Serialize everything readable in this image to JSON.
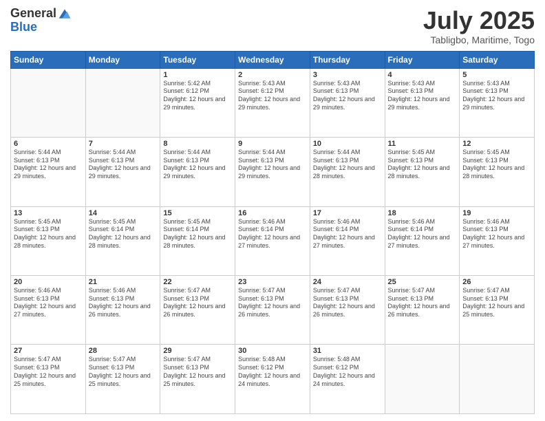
{
  "logo": {
    "general": "General",
    "blue": "Blue"
  },
  "title": "July 2025",
  "subtitle": "Tabligbo, Maritime, Togo",
  "days_of_week": [
    "Sunday",
    "Monday",
    "Tuesday",
    "Wednesday",
    "Thursday",
    "Friday",
    "Saturday"
  ],
  "weeks": [
    [
      {
        "day": "",
        "info": ""
      },
      {
        "day": "",
        "info": ""
      },
      {
        "day": "1",
        "info": "Sunrise: 5:42 AM\nSunset: 6:12 PM\nDaylight: 12 hours and 29 minutes."
      },
      {
        "day": "2",
        "info": "Sunrise: 5:43 AM\nSunset: 6:12 PM\nDaylight: 12 hours and 29 minutes."
      },
      {
        "day": "3",
        "info": "Sunrise: 5:43 AM\nSunset: 6:13 PM\nDaylight: 12 hours and 29 minutes."
      },
      {
        "day": "4",
        "info": "Sunrise: 5:43 AM\nSunset: 6:13 PM\nDaylight: 12 hours and 29 minutes."
      },
      {
        "day": "5",
        "info": "Sunrise: 5:43 AM\nSunset: 6:13 PM\nDaylight: 12 hours and 29 minutes."
      }
    ],
    [
      {
        "day": "6",
        "info": "Sunrise: 5:44 AM\nSunset: 6:13 PM\nDaylight: 12 hours and 29 minutes."
      },
      {
        "day": "7",
        "info": "Sunrise: 5:44 AM\nSunset: 6:13 PM\nDaylight: 12 hours and 29 minutes."
      },
      {
        "day": "8",
        "info": "Sunrise: 5:44 AM\nSunset: 6:13 PM\nDaylight: 12 hours and 29 minutes."
      },
      {
        "day": "9",
        "info": "Sunrise: 5:44 AM\nSunset: 6:13 PM\nDaylight: 12 hours and 29 minutes."
      },
      {
        "day": "10",
        "info": "Sunrise: 5:44 AM\nSunset: 6:13 PM\nDaylight: 12 hours and 28 minutes."
      },
      {
        "day": "11",
        "info": "Sunrise: 5:45 AM\nSunset: 6:13 PM\nDaylight: 12 hours and 28 minutes."
      },
      {
        "day": "12",
        "info": "Sunrise: 5:45 AM\nSunset: 6:13 PM\nDaylight: 12 hours and 28 minutes."
      }
    ],
    [
      {
        "day": "13",
        "info": "Sunrise: 5:45 AM\nSunset: 6:13 PM\nDaylight: 12 hours and 28 minutes."
      },
      {
        "day": "14",
        "info": "Sunrise: 5:45 AM\nSunset: 6:14 PM\nDaylight: 12 hours and 28 minutes."
      },
      {
        "day": "15",
        "info": "Sunrise: 5:45 AM\nSunset: 6:14 PM\nDaylight: 12 hours and 28 minutes."
      },
      {
        "day": "16",
        "info": "Sunrise: 5:46 AM\nSunset: 6:14 PM\nDaylight: 12 hours and 27 minutes."
      },
      {
        "day": "17",
        "info": "Sunrise: 5:46 AM\nSunset: 6:14 PM\nDaylight: 12 hours and 27 minutes."
      },
      {
        "day": "18",
        "info": "Sunrise: 5:46 AM\nSunset: 6:14 PM\nDaylight: 12 hours and 27 minutes."
      },
      {
        "day": "19",
        "info": "Sunrise: 5:46 AM\nSunset: 6:13 PM\nDaylight: 12 hours and 27 minutes."
      }
    ],
    [
      {
        "day": "20",
        "info": "Sunrise: 5:46 AM\nSunset: 6:13 PM\nDaylight: 12 hours and 27 minutes."
      },
      {
        "day": "21",
        "info": "Sunrise: 5:46 AM\nSunset: 6:13 PM\nDaylight: 12 hours and 26 minutes."
      },
      {
        "day": "22",
        "info": "Sunrise: 5:47 AM\nSunset: 6:13 PM\nDaylight: 12 hours and 26 minutes."
      },
      {
        "day": "23",
        "info": "Sunrise: 5:47 AM\nSunset: 6:13 PM\nDaylight: 12 hours and 26 minutes."
      },
      {
        "day": "24",
        "info": "Sunrise: 5:47 AM\nSunset: 6:13 PM\nDaylight: 12 hours and 26 minutes."
      },
      {
        "day": "25",
        "info": "Sunrise: 5:47 AM\nSunset: 6:13 PM\nDaylight: 12 hours and 26 minutes."
      },
      {
        "day": "26",
        "info": "Sunrise: 5:47 AM\nSunset: 6:13 PM\nDaylight: 12 hours and 25 minutes."
      }
    ],
    [
      {
        "day": "27",
        "info": "Sunrise: 5:47 AM\nSunset: 6:13 PM\nDaylight: 12 hours and 25 minutes."
      },
      {
        "day": "28",
        "info": "Sunrise: 5:47 AM\nSunset: 6:13 PM\nDaylight: 12 hours and 25 minutes."
      },
      {
        "day": "29",
        "info": "Sunrise: 5:47 AM\nSunset: 6:13 PM\nDaylight: 12 hours and 25 minutes."
      },
      {
        "day": "30",
        "info": "Sunrise: 5:48 AM\nSunset: 6:12 PM\nDaylight: 12 hours and 24 minutes."
      },
      {
        "day": "31",
        "info": "Sunrise: 5:48 AM\nSunset: 6:12 PM\nDaylight: 12 hours and 24 minutes."
      },
      {
        "day": "",
        "info": ""
      },
      {
        "day": "",
        "info": ""
      }
    ]
  ]
}
